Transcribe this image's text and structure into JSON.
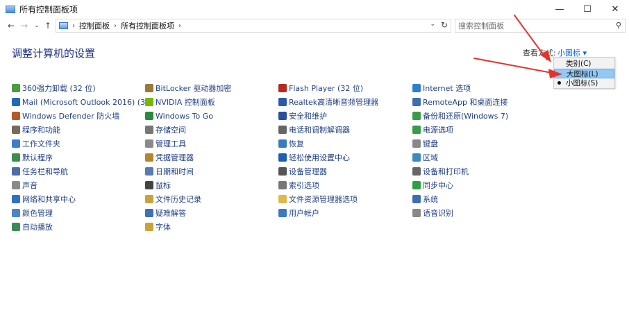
{
  "window": {
    "title": "所有控制面板项",
    "buttons": {
      "minimize": "—",
      "maximize": "☐",
      "close": "✕"
    }
  },
  "nav": {
    "back": "←",
    "forward": "→",
    "recent": "⌄",
    "up": "↑",
    "breadcrumb": [
      "控制面板",
      "所有控制面板项"
    ],
    "refresh": "↻",
    "search_placeholder": "搜索控制面板"
  },
  "main": {
    "heading": "调整计算机的设置",
    "view_by_label": "查看方式:",
    "view_by_value": "小图标 ▾"
  },
  "view_menu": {
    "items": [
      {
        "label": "类别(C)"
      },
      {
        "label": "大图标(L)"
      },
      {
        "label": "小图标(S)"
      }
    ]
  },
  "columns": [
    [
      {
        "label": "360强力卸载 (32 位)",
        "icon": "uninstall-icon",
        "color": "#4a9d3c"
      },
      {
        "label": "Mail (Microsoft Outlook 2016) (3...",
        "icon": "mail-icon",
        "color": "#1e6bb8"
      },
      {
        "label": "Windows Defender 防火墙",
        "icon": "firewall-icon",
        "color": "#b8572b"
      },
      {
        "label": "程序和功能",
        "icon": "programs-icon",
        "color": "#7a6a5a"
      },
      {
        "label": "工作文件夹",
        "icon": "work-folders-icon",
        "color": "#3b7ed0"
      },
      {
        "label": "默认程序",
        "icon": "default-programs-icon",
        "color": "#3c8f4a"
      },
      {
        "label": "任务栏和导航",
        "icon": "taskbar-icon",
        "color": "#4a6fa8"
      },
      {
        "label": "声音",
        "icon": "sound-icon",
        "color": "#8a8a8a"
      },
      {
        "label": "网络和共享中心",
        "icon": "network-icon",
        "color": "#2d72c4"
      },
      {
        "label": "颜色管理",
        "icon": "color-management-icon",
        "color": "#4a86c9"
      },
      {
        "label": "自动播放",
        "icon": "autoplay-icon",
        "color": "#3b8a5a"
      }
    ],
    [
      {
        "label": "BitLocker 驱动器加密",
        "icon": "bitlocker-icon",
        "color": "#9a7a3a"
      },
      {
        "label": "NVIDIA 控制面板",
        "icon": "nvidia-icon",
        "color": "#76b900"
      },
      {
        "label": "Windows To Go",
        "icon": "windows-to-go-icon",
        "color": "#2c8a3a"
      },
      {
        "label": "存储空间",
        "icon": "storage-icon",
        "color": "#777777"
      },
      {
        "label": "管理工具",
        "icon": "admin-tools-icon",
        "color": "#8a8a8a"
      },
      {
        "label": "凭据管理器",
        "icon": "credential-icon",
        "color": "#b8862a"
      },
      {
        "label": "日期和时间",
        "icon": "datetime-icon",
        "color": "#5a7ab0"
      },
      {
        "label": "鼠标",
        "icon": "mouse-icon",
        "color": "#444444"
      },
      {
        "label": "文件历史记录",
        "icon": "file-history-icon",
        "color": "#c9a23a"
      },
      {
        "label": "疑难解答",
        "icon": "troubleshoot-icon",
        "color": "#3f6fb5"
      },
      {
        "label": "字体",
        "icon": "fonts-icon",
        "color": "#c9a23a"
      }
    ],
    [
      {
        "label": "Flash Player (32 位)",
        "icon": "flash-icon",
        "color": "#b52a1e"
      },
      {
        "label": "Realtek高清晰音频管理器",
        "icon": "realtek-icon",
        "color": "#2a5aa8"
      },
      {
        "label": "安全和维护",
        "icon": "security-flag-icon",
        "color": "#2a4fa0"
      },
      {
        "label": "电话和调制解调器",
        "icon": "phone-icon",
        "color": "#666666"
      },
      {
        "label": "恢复",
        "icon": "recovery-icon",
        "color": "#3a7ac0"
      },
      {
        "label": "轻松使用设置中心",
        "icon": "ease-of-access-icon",
        "color": "#1f5fb0"
      },
      {
        "label": "设备管理器",
        "icon": "device-manager-icon",
        "color": "#555555"
      },
      {
        "label": "索引选项",
        "icon": "indexing-icon",
        "color": "#777777"
      },
      {
        "label": "文件资源管理器选项",
        "icon": "explorer-options-icon",
        "color": "#e0b84a"
      },
      {
        "label": "用户帐户",
        "icon": "user-accounts-icon",
        "color": "#3a7ac0"
      }
    ],
    [
      {
        "label": "Internet 选项",
        "icon": "internet-icon",
        "color": "#2f7fd0"
      },
      {
        "label": "RemoteApp 和桌面连接",
        "icon": "remoteapp-icon",
        "color": "#3a6fb0"
      },
      {
        "label": "备份和还原(Windows 7)",
        "icon": "backup-icon",
        "color": "#3c9a4a"
      },
      {
        "label": "电源选项",
        "icon": "power-icon",
        "color": "#3c9a4a"
      },
      {
        "label": "键盘",
        "icon": "keyboard-icon",
        "color": "#888888"
      },
      {
        "label": "区域",
        "icon": "region-icon",
        "color": "#3a8ac0"
      },
      {
        "label": "设备和打印机",
        "icon": "printer-icon",
        "color": "#666666"
      },
      {
        "label": "同步中心",
        "icon": "sync-icon",
        "color": "#2ea043"
      },
      {
        "label": "系统",
        "icon": "system-icon",
        "color": "#3a6fb0"
      },
      {
        "label": "语音识别",
        "icon": "speech-icon",
        "color": "#888888"
      }
    ]
  ],
  "colors": {
    "heading": "#1e3287",
    "link": "#1f3f84",
    "view_value": "#0066cc",
    "menu_highlight": "#91c9f7",
    "annotation_arrow": "#e8312a"
  }
}
